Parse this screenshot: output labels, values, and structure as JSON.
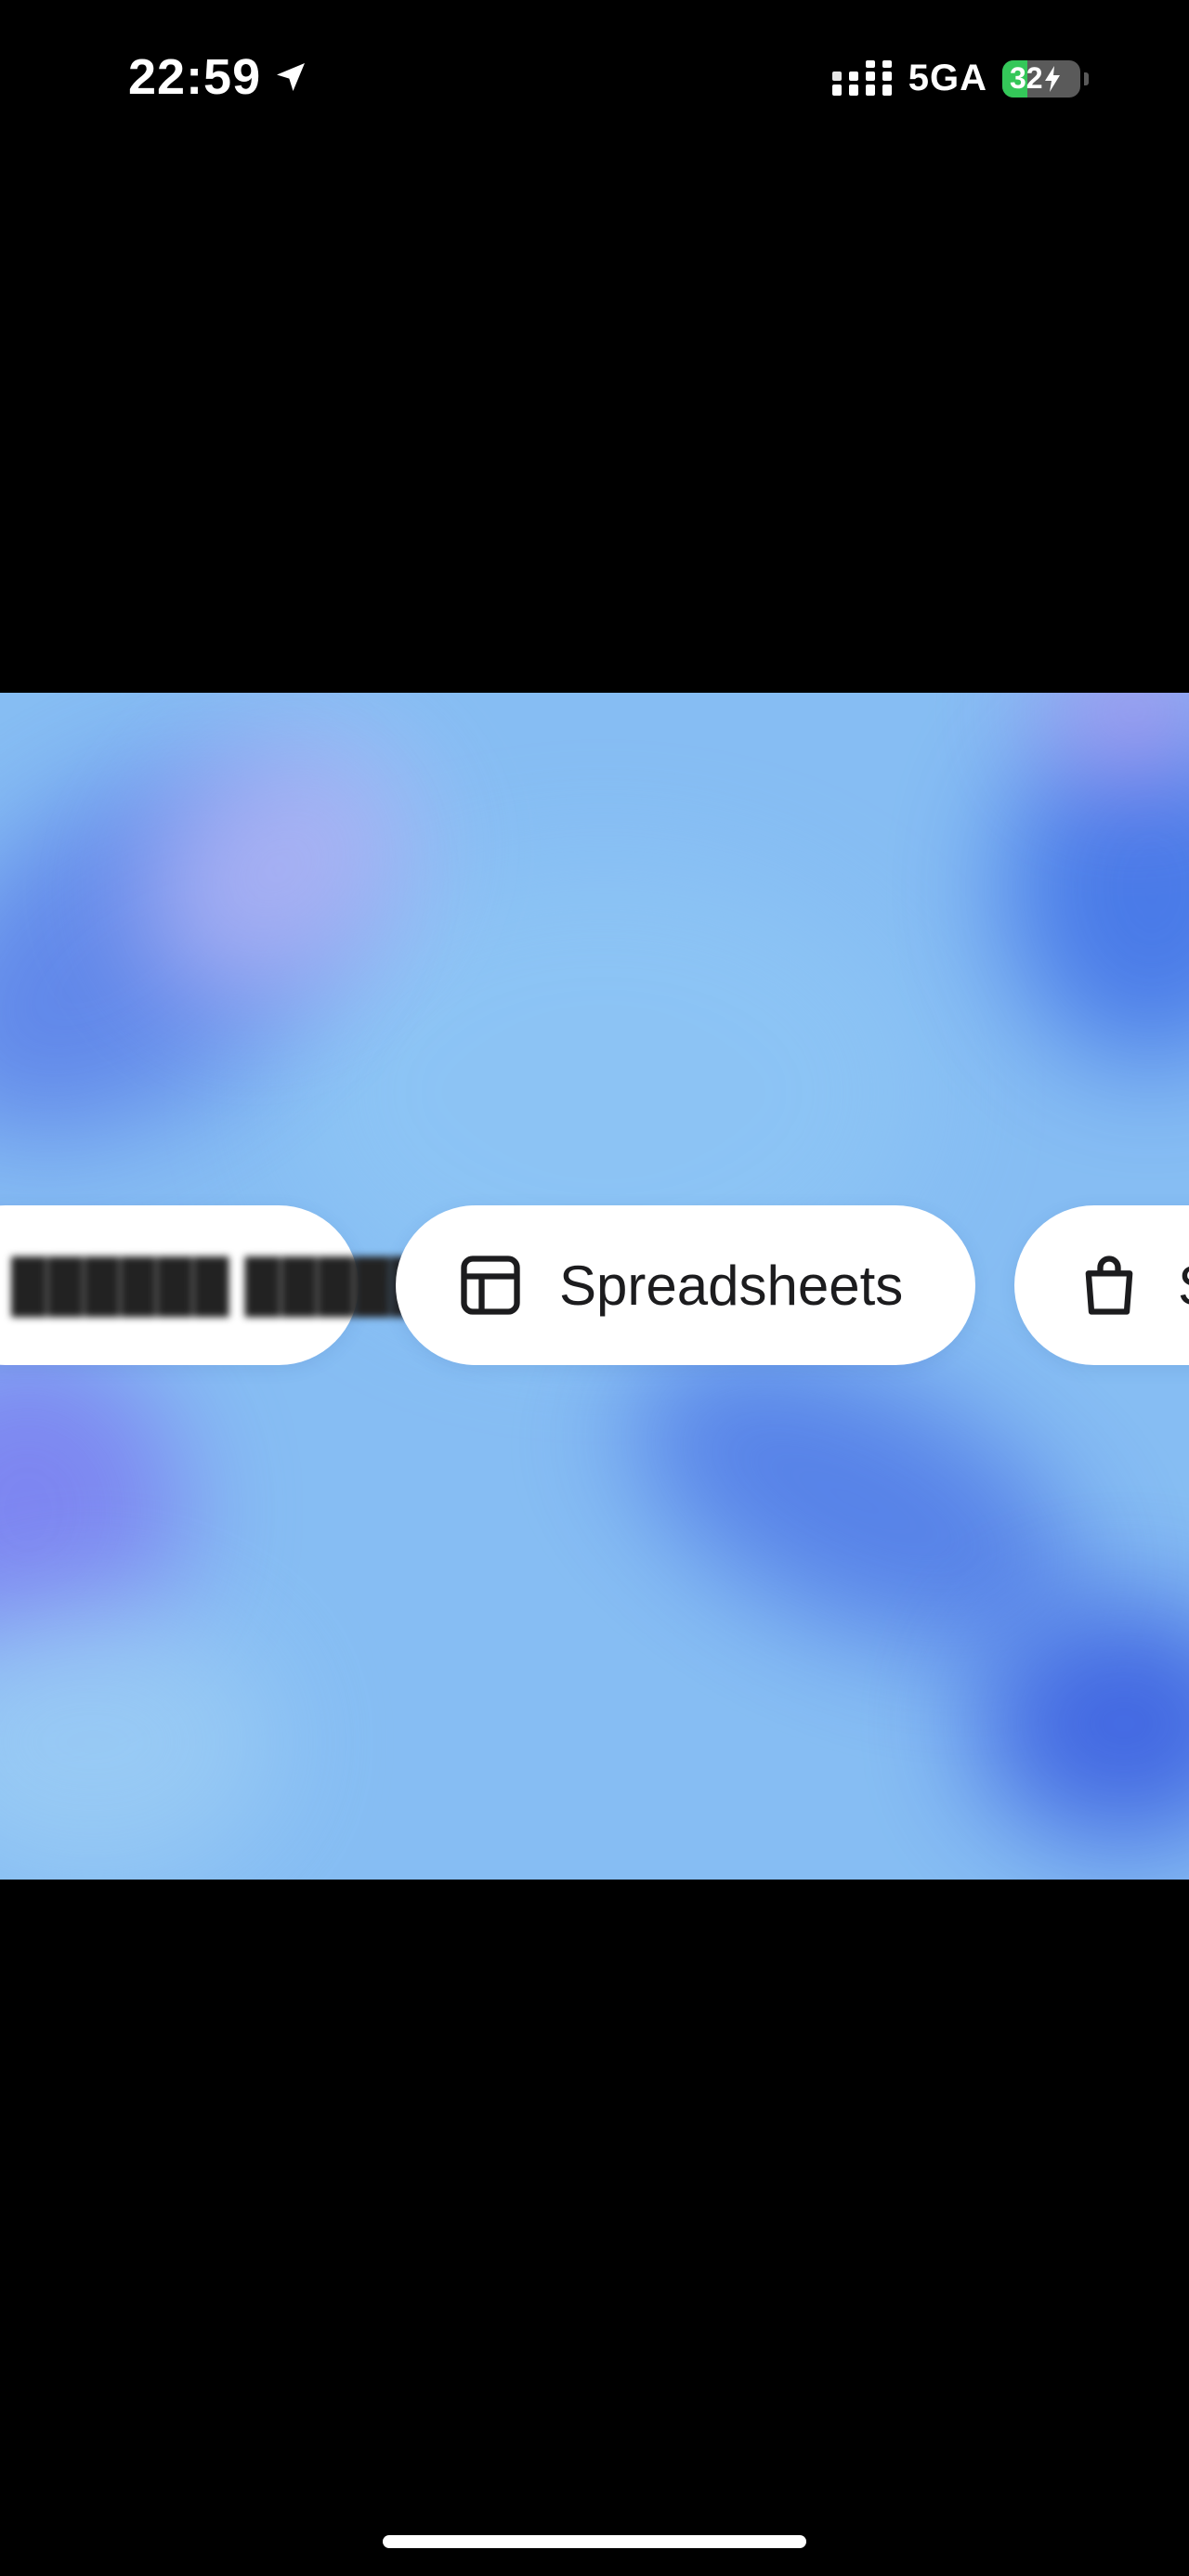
{
  "status_bar": {
    "time": "22:59",
    "network": "5GA",
    "battery_level": 32,
    "battery_text": "32",
    "icons": [
      "location-arrow-icon",
      "cellular-signal-icon",
      "battery-icon",
      "charging-bolt-icon"
    ]
  },
  "media": {
    "pills": [
      {
        "label": "",
        "icon": null,
        "redacted": true
      },
      {
        "label": "Spreadsheets",
        "icon": "table-icon"
      },
      {
        "label": "S",
        "icon": "shopping-bag-icon"
      }
    ]
  },
  "colors": {
    "background": "#000000",
    "media_background": "#86bdf3",
    "pill_background": "#ffffff",
    "pill_text": "#1c1c1e",
    "battery_fill": "#34c759"
  }
}
